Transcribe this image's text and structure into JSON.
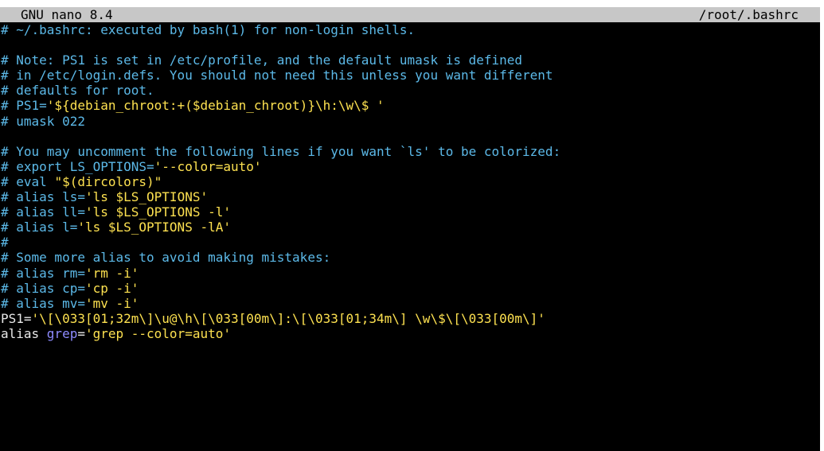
{
  "titlebar": {
    "app": "GNU nano 8.4",
    "filename": "/root/.bashrc"
  },
  "lines": [
    [
      {
        "t": "# ~/.bashrc: executed by bash(1) for non-login shells.",
        "c": "comment"
      }
    ],
    [],
    [
      {
        "t": "# Note: PS1 is set in /etc/profile, and the default umask is defined",
        "c": "comment"
      }
    ],
    [
      {
        "t": "# in /etc/login.defs. You should not need this unless you want different",
        "c": "comment"
      }
    ],
    [
      {
        "t": "# defaults for root.",
        "c": "comment"
      }
    ],
    [
      {
        "t": "# PS1=",
        "c": "comment"
      },
      {
        "t": "'${debian_chroot:+($debian_chroot)}\\h:\\w\\$ '",
        "c": "str"
      }
    ],
    [
      {
        "t": "# umask 022",
        "c": "comment"
      }
    ],
    [],
    [
      {
        "t": "# You may uncomment the following lines if you want `ls' to be colorized:",
        "c": "comment"
      }
    ],
    [
      {
        "t": "# export LS_OPTIONS=",
        "c": "comment"
      },
      {
        "t": "'--color=auto'",
        "c": "str"
      }
    ],
    [
      {
        "t": "# eval ",
        "c": "comment"
      },
      {
        "t": "\"$(dircolors)\"",
        "c": "str"
      }
    ],
    [
      {
        "t": "# alias ls=",
        "c": "comment"
      },
      {
        "t": "'ls $LS_OPTIONS'",
        "c": "str"
      }
    ],
    [
      {
        "t": "# alias ll=",
        "c": "comment"
      },
      {
        "t": "'ls $LS_OPTIONS -l'",
        "c": "str"
      }
    ],
    [
      {
        "t": "# alias l=",
        "c": "comment"
      },
      {
        "t": "'ls $LS_OPTIONS -lA'",
        "c": "str"
      }
    ],
    [
      {
        "t": "#",
        "c": "comment"
      }
    ],
    [
      {
        "t": "# Some more alias to avoid making mistakes:",
        "c": "comment"
      }
    ],
    [
      {
        "t": "# alias rm=",
        "c": "comment"
      },
      {
        "t": "'rm -i'",
        "c": "str"
      }
    ],
    [
      {
        "t": "# alias cp=",
        "c": "comment"
      },
      {
        "t": "'cp -i'",
        "c": "str"
      }
    ],
    [
      {
        "t": "# alias mv=",
        "c": "comment"
      },
      {
        "t": "'mv -i'",
        "c": "str"
      }
    ],
    [
      {
        "t": "PS1=",
        "c": "plain"
      },
      {
        "t": "'\\[\\033[01;32m\\]\\u@\\h\\[\\033[00m\\]:\\[\\033[01;34m\\] \\w\\$\\[\\033[00m\\]'",
        "c": "str"
      }
    ],
    [
      {
        "t": "alias ",
        "c": "plain"
      },
      {
        "t": "grep",
        "c": "kw"
      },
      {
        "t": "=",
        "c": "plain"
      },
      {
        "t": "'grep --color=auto'",
        "c": "str"
      }
    ]
  ],
  "colors": {
    "background": "#000000",
    "titlebar_bg": "#c7c7c7",
    "comment": "#5cb9e8",
    "string": "#fde150",
    "keyword": "#8e8bff",
    "plain": "#e9e9e9"
  }
}
